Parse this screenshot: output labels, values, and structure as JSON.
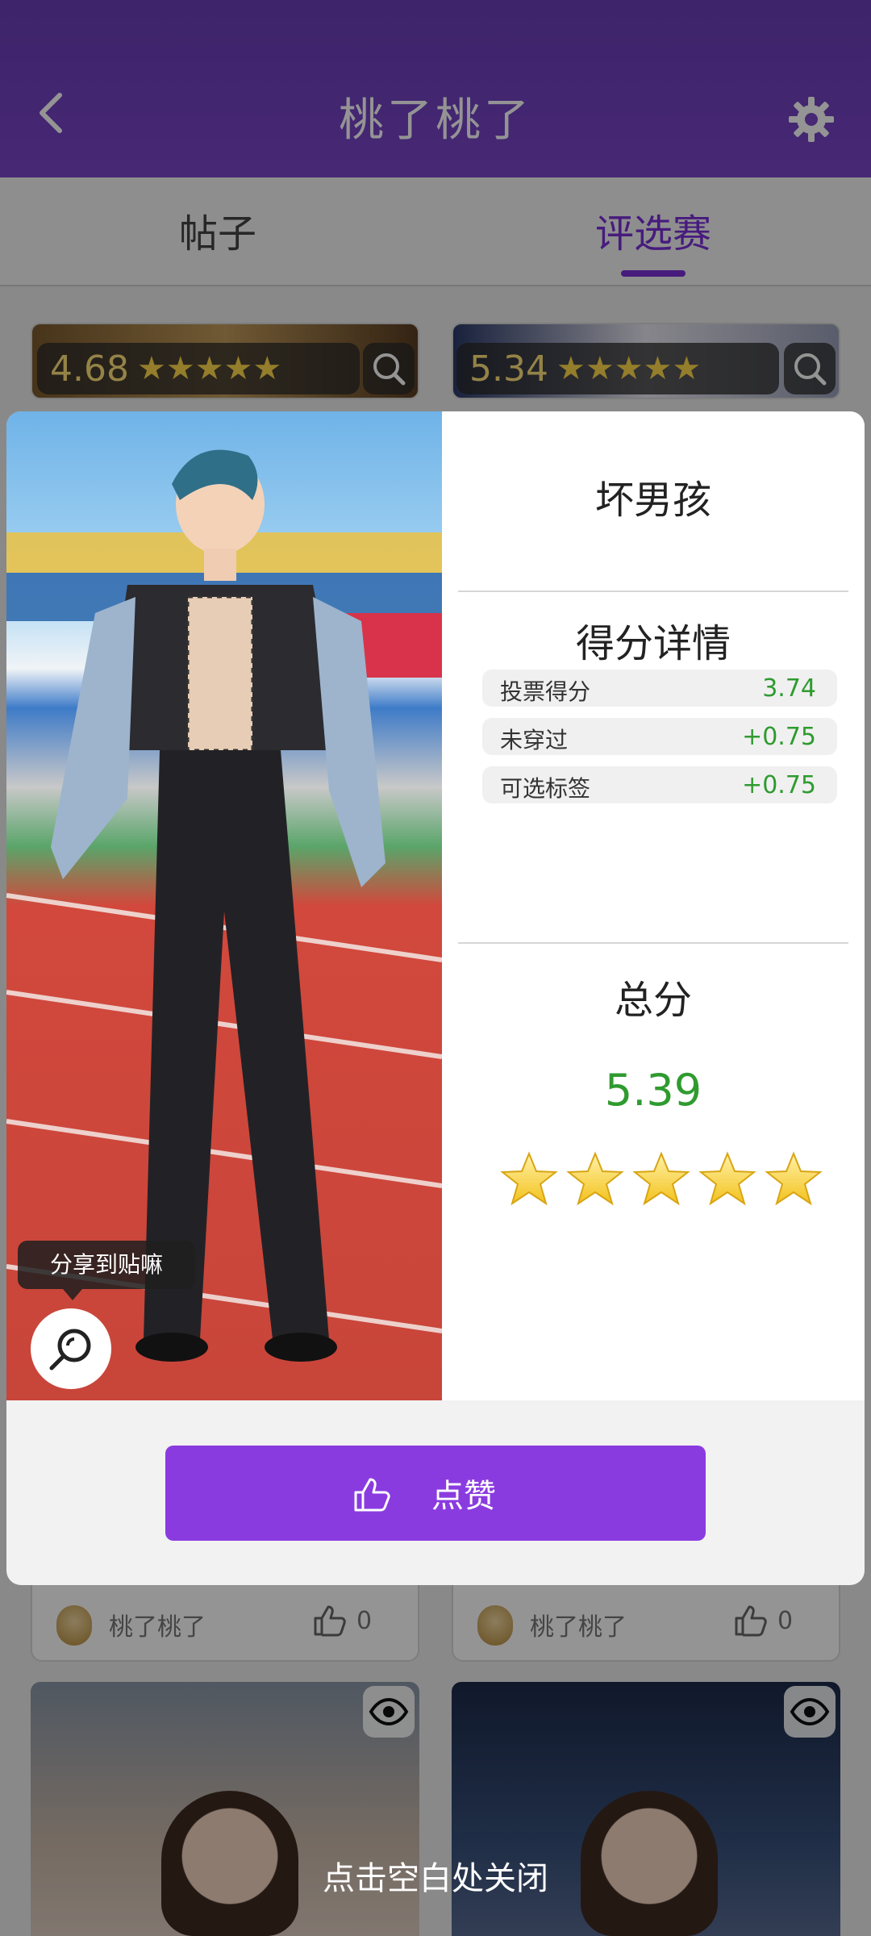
{
  "header": {
    "title": "桃了桃了",
    "back_icon": "back-arrow-icon",
    "settings_icon": "gear-icon"
  },
  "tabs": [
    {
      "label": "帖子",
      "active": false
    },
    {
      "label": "评选赛",
      "active": true
    }
  ],
  "background_cards": {
    "top": [
      {
        "score": "4.68",
        "stars": "★★★★★"
      },
      {
        "score": "5.34",
        "stars": "★★★★★"
      }
    ],
    "footers": [
      {
        "author": "桃了桃了",
        "likes": "0"
      },
      {
        "author": "桃了桃了",
        "likes": "0"
      }
    ]
  },
  "modal": {
    "outfit_name": "坏男孩",
    "share_tip": "分享到贴嘛",
    "score_details": {
      "title": "得分详情",
      "rows": [
        {
          "label": "投票得分",
          "value": "3.74"
        },
        {
          "label": "未穿过",
          "value": "+0.75"
        },
        {
          "label": "可选标签",
          "value": "+0.75"
        }
      ]
    },
    "total": {
      "title": "总分",
      "value": "5.39",
      "stars": 5
    },
    "like_button": {
      "label": "点赞",
      "icon": "thumbs-up-icon"
    }
  },
  "close_hint": "点击空白处关闭",
  "colors": {
    "accent": "#8a3be0",
    "header": "#7a45c9",
    "score_green": "#2f9b2f",
    "star": "#ffd84a"
  }
}
